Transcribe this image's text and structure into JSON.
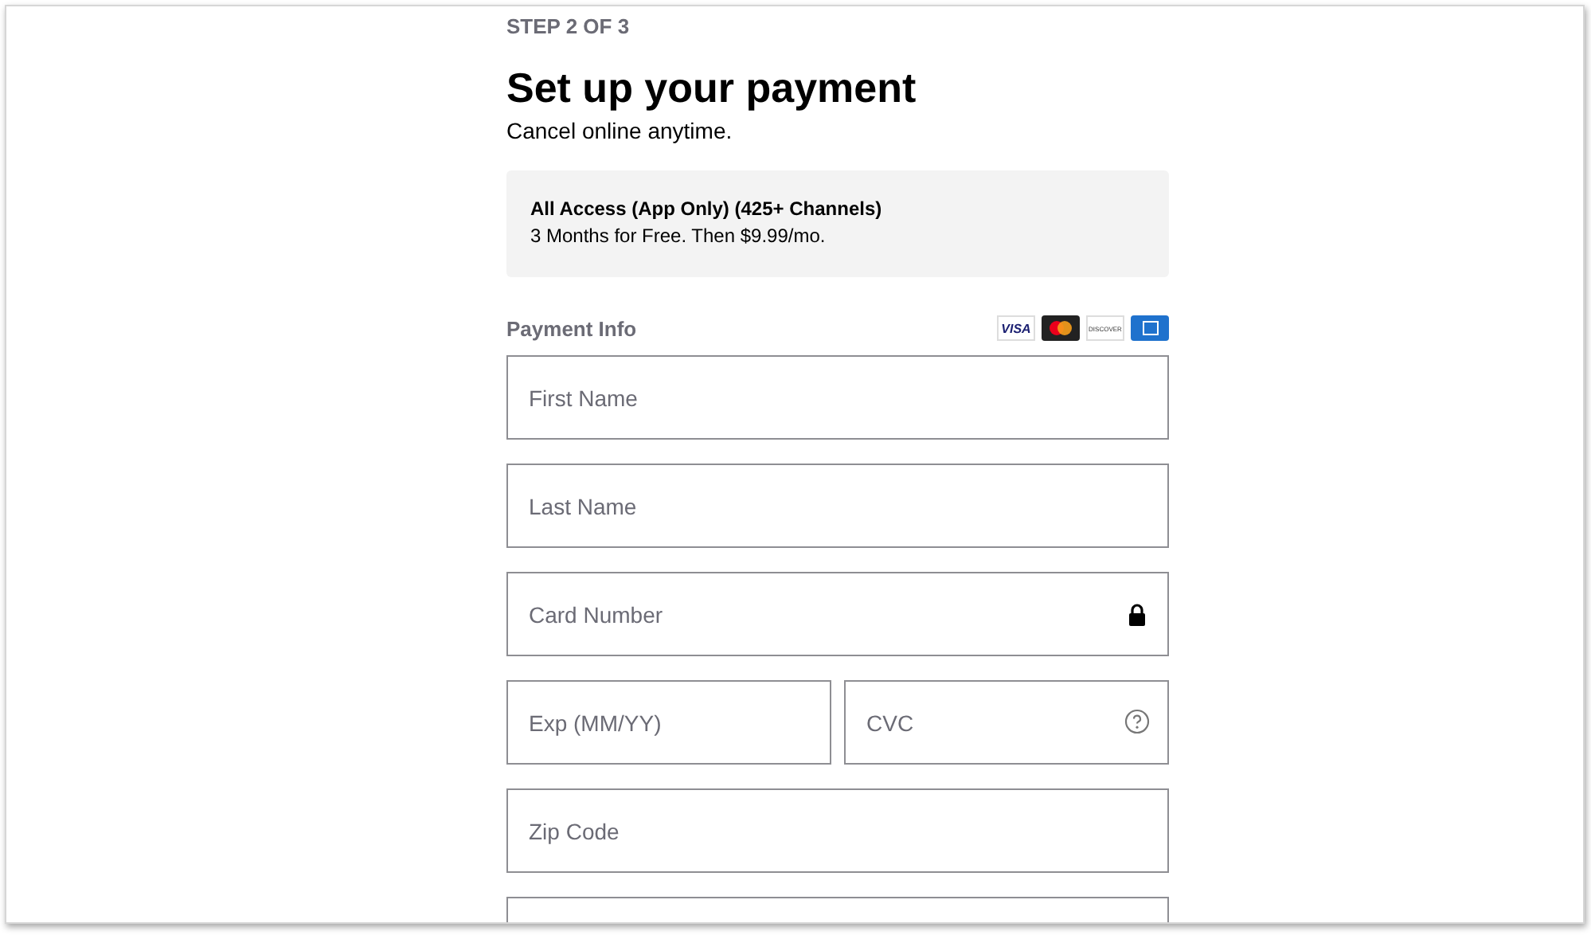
{
  "step": "STEP 2 OF 3",
  "title": "Set up your payment",
  "subtitle": "Cancel online anytime.",
  "plan": {
    "name": "All Access (App Only) (425+ Channels)",
    "offer": "3 Months for Free. Then $9.99/mo."
  },
  "payment_info": {
    "label": "Payment Info",
    "cards": [
      {
        "kind": "visa",
        "label": "VISA"
      },
      {
        "kind": "mastercard"
      },
      {
        "kind": "discover",
        "label": "DISCOVER"
      },
      {
        "kind": "amex"
      }
    ]
  },
  "rows": [
    [
      {
        "placeholder": "First Name",
        "kind": "text"
      }
    ],
    [
      {
        "placeholder": "Last Name",
        "kind": "text"
      }
    ],
    [
      {
        "placeholder": "Card Number",
        "kind": "secure"
      }
    ],
    [
      {
        "placeholder": "Exp (MM/YY)",
        "kind": "text"
      },
      {
        "placeholder": "CVC",
        "kind": "help"
      }
    ],
    [
      {
        "placeholder": "Zip Code",
        "kind": "text"
      }
    ],
    [
      {
        "kind": "text"
      }
    ]
  ]
}
